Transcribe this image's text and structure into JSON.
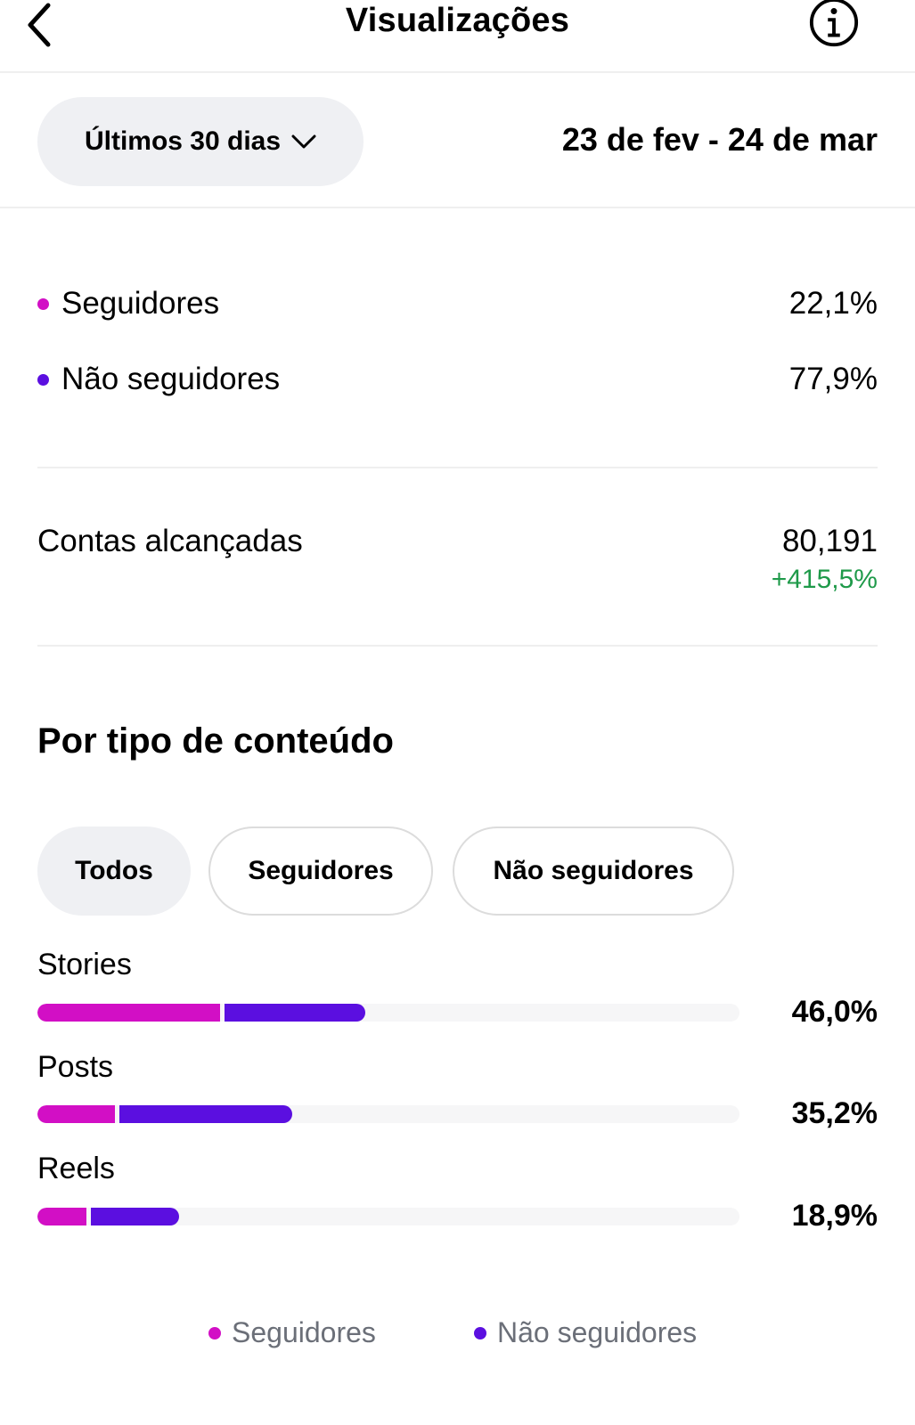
{
  "header": {
    "title": "Visualizações",
    "back_icon": "chevron-left-icon",
    "info_icon": "info-icon"
  },
  "period": {
    "label": "Últimos 30 dias",
    "date_range": "23 de fev - 24 de mar"
  },
  "colors": {
    "followers": "#d20fc5",
    "non_followers": "#5b0fe0",
    "positive": "#1f9a4a"
  },
  "audience": [
    {
      "label": "Seguidores",
      "value": "22,1%"
    },
    {
      "label": "Não seguidores",
      "value": "77,9%"
    }
  ],
  "reach": {
    "label": "Contas alcançadas",
    "value": "80,191",
    "change": "+415,5%"
  },
  "content_type": {
    "title": "Por tipo de conteúdo",
    "filters": [
      "Todos",
      "Seguidores",
      "Não seguidores"
    ],
    "selected_filter": "Todos",
    "rows": [
      {
        "label": "Stories",
        "percent": "46,0%",
        "followers_share": 0.26,
        "non_followers_share": 0.2
      },
      {
        "label": "Posts",
        "percent": "35,2%",
        "followers_share": 0.11,
        "non_followers_share": 0.246
      },
      {
        "label": "Reels",
        "percent": "18,9%",
        "followers_share": 0.07,
        "non_followers_share": 0.125
      }
    ],
    "legend": [
      "Seguidores",
      "Não seguidores"
    ]
  }
}
